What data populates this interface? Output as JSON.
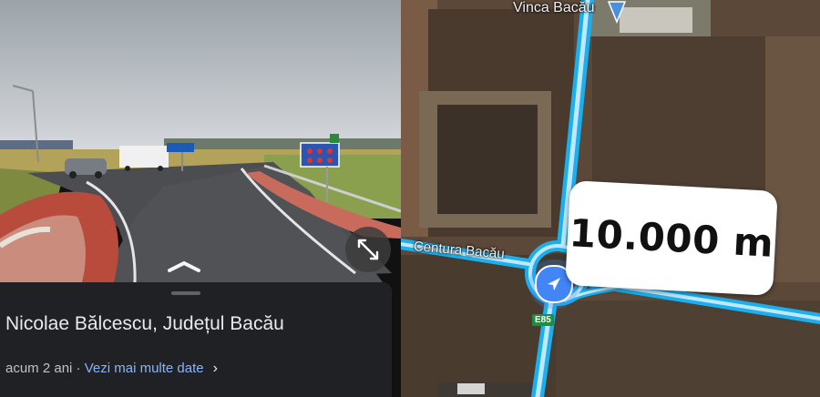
{
  "street_view": {
    "place_title": "Nicolae Bălcescu, Județul Bacău",
    "age": "acum 2 ani",
    "separator": " · ",
    "more_link": "Vezi mai multe date",
    "chevron": "›",
    "expand_icon": "expand-arrows-icon",
    "nav_arrow_icon": "chevron-up-icon"
  },
  "map": {
    "top_label": "Vinca Bacău",
    "road_label": "Centura Bacău",
    "route_badge": "E85",
    "distance_label": "10.000 m",
    "colors": {
      "road_outline": "#1ab0f0",
      "road_fill": "#bfe9fb",
      "location_dot": "#4285f4",
      "route_badge": "#1e8e3e"
    }
  }
}
